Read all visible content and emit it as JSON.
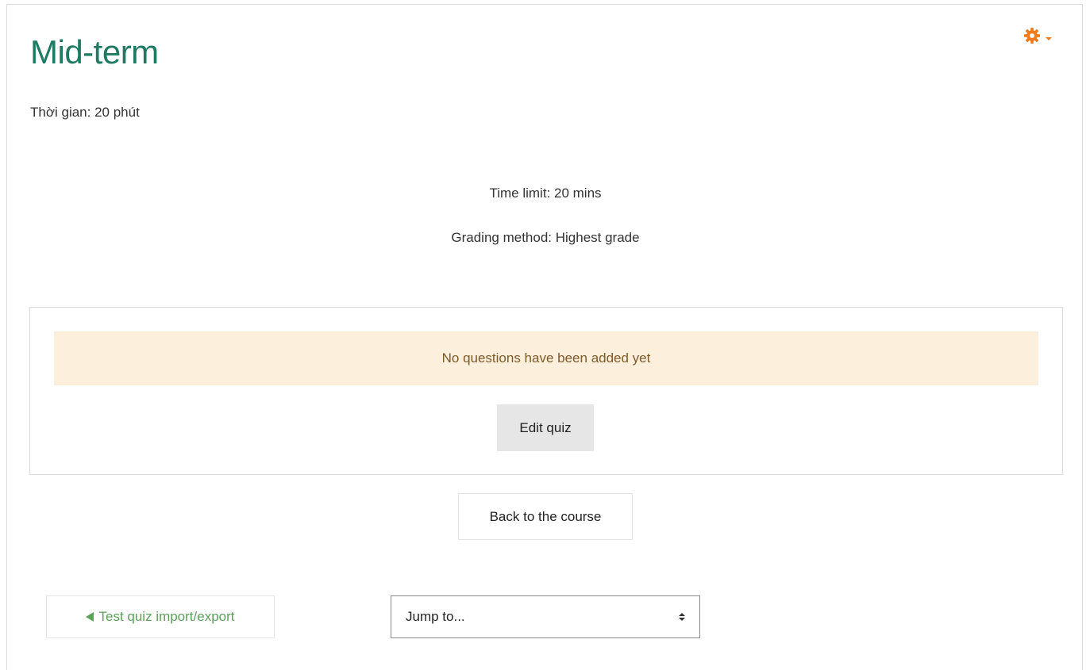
{
  "quiz": {
    "title": "Mid-term",
    "intro": "Thời gian: 20 phút",
    "time_limit": "Time limit: 20 mins",
    "grading_method": "Grading method: Highest grade"
  },
  "settings_menu": {
    "icon": "gear-icon",
    "color": "#f07b1d"
  },
  "notice": {
    "message": "No questions have been added yet",
    "background": "#fcefdc"
  },
  "buttons": {
    "edit_quiz": "Edit quiz",
    "back_to_course": "Back to the course"
  },
  "navigation": {
    "prev_activity": "Test quiz import/export",
    "jump_to": {
      "selected": "Jump to..."
    }
  },
  "colors": {
    "title": "#1f7a63",
    "link": "#5aa15a"
  }
}
